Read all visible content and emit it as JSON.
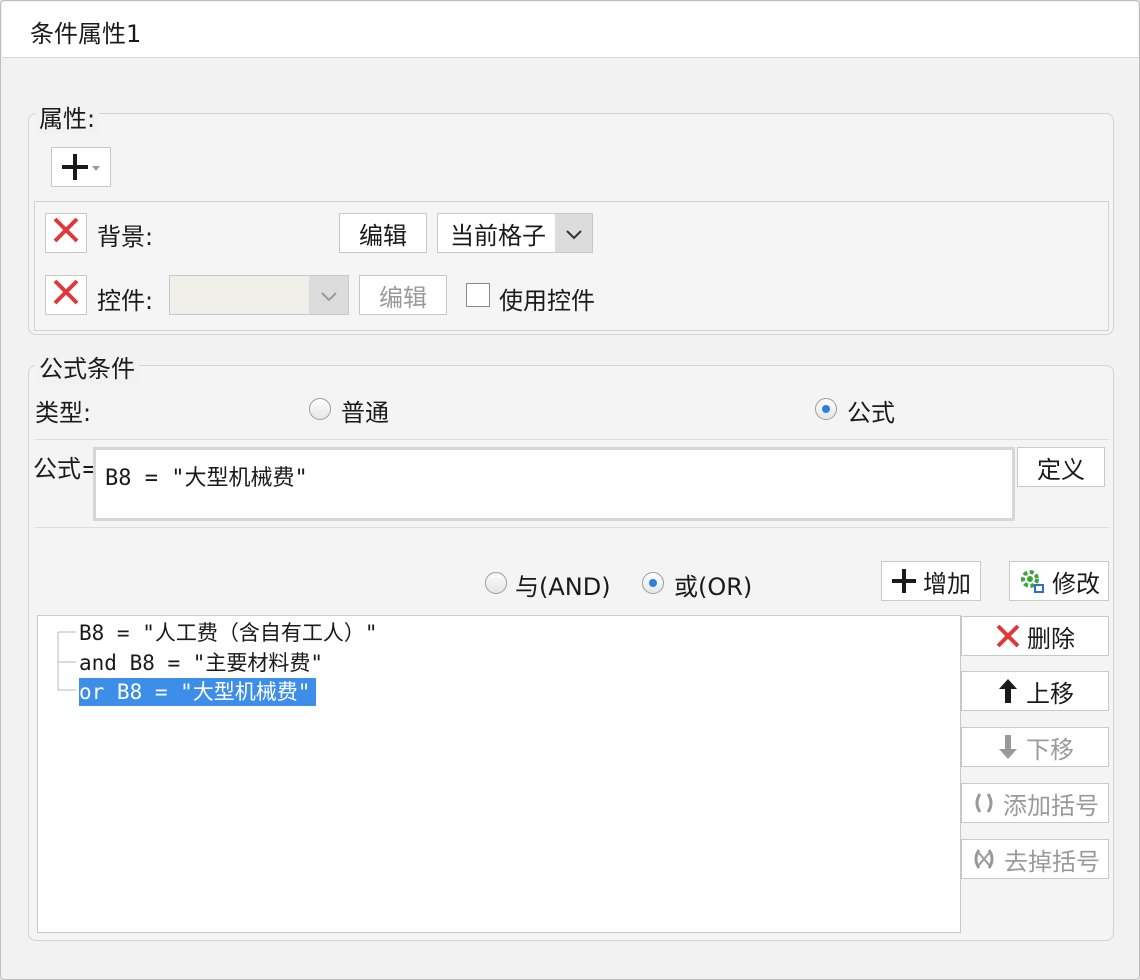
{
  "tab": {
    "title": "条件属性1"
  },
  "properties": {
    "legend": "属性:",
    "add_button_icon": "plus-dropdown-icon",
    "background": {
      "label": "背景:",
      "edit_label": "编辑",
      "scope_value": "当前格子"
    },
    "widget": {
      "label": "控件:",
      "select_value": "",
      "edit_label": "编辑",
      "use_widget_label": "使用控件",
      "use_widget_checked": false
    }
  },
  "formula_condition": {
    "legend": "公式条件",
    "type_label": "类型:",
    "type_options": [
      "普通",
      "公式"
    ],
    "type_selected": "公式",
    "formula_label": "公式=",
    "formula_value": "B8 = \"大型机械费\"",
    "define_label": "定义",
    "logic_options": [
      "与(AND)",
      "或(OR)"
    ],
    "logic_selected": "或(OR)",
    "add_label": "增加",
    "modify_label": "修改",
    "tree": [
      {
        "text": "B8 = \"人工费（含自有工人）\"",
        "selected": false
      },
      {
        "text": "and B8 = \"主要材料费\"",
        "selected": false
      },
      {
        "text": "or  B8 = \"大型机械费\"",
        "selected": true
      }
    ],
    "side_buttons": {
      "delete": "删除",
      "move_up": "上移",
      "move_down": "下移",
      "add_bracket": "添加括号",
      "remove_bracket": "去掉括号"
    }
  },
  "colors": {
    "accent": "#2f7de1",
    "selection": "#3d8ee8",
    "delete_red": "#e0383b",
    "gear_green": "#3aa53a"
  }
}
